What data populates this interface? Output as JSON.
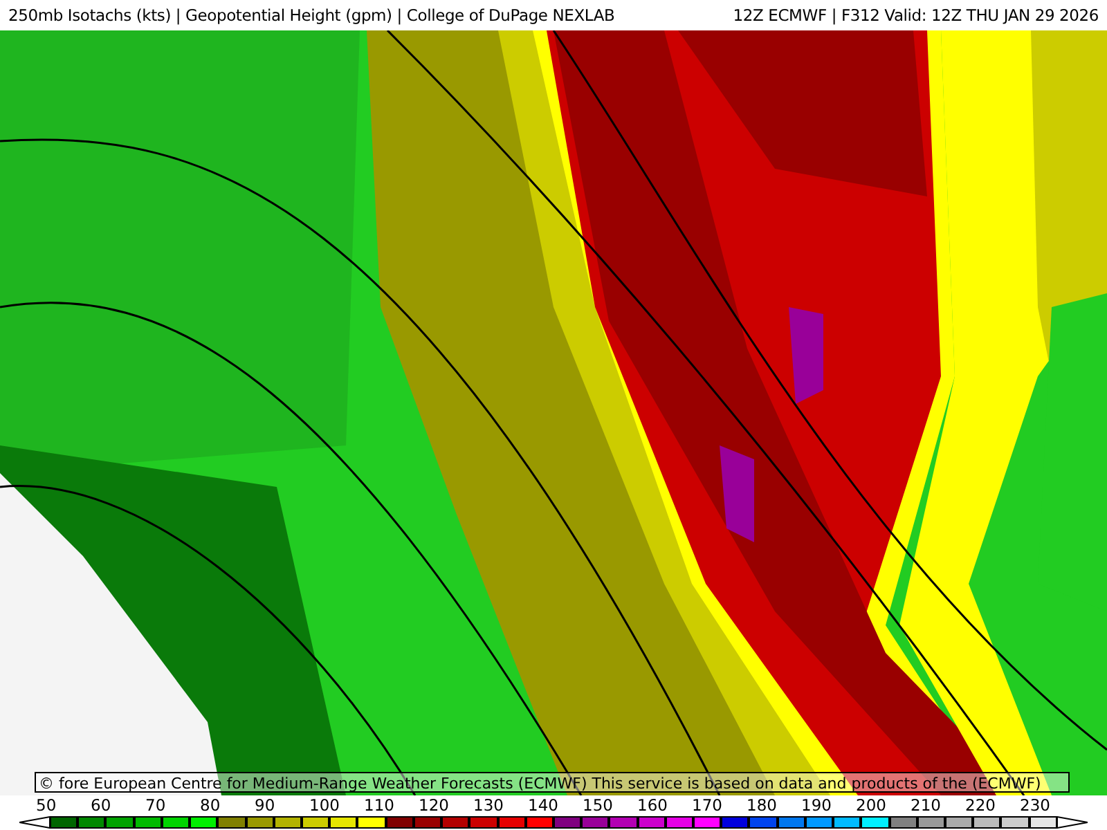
{
  "header": {
    "title": "250mb Isotachs (kts) | Geopotential Height (gpm) | College of DuPage NEXLAB",
    "run": "12Z ECMWF | F312 Valid: 12Z THU JAN 29 2026"
  },
  "copyright": "© fore European Centre for Medium-Range Weather Forecasts (ECMWF)  This service is based on data and products of the (ECMWF)",
  "colorbar": {
    "labels": [
      "50",
      "60",
      "70",
      "80",
      "90",
      "100",
      "110",
      "120",
      "130",
      "140",
      "150",
      "160",
      "170",
      "180",
      "190",
      "200",
      "210",
      "220",
      "230"
    ],
    "swatches": [
      {
        "color": "#006600"
      },
      {
        "color": "#008800"
      },
      {
        "color": "#00a300"
      },
      {
        "color": "#00bb00"
      },
      {
        "color": "#00d400"
      },
      {
        "color": "#00ee00"
      },
      {
        "color": "#808000"
      },
      {
        "color": "#999900"
      },
      {
        "color": "#b3b300"
      },
      {
        "color": "#cccc00"
      },
      {
        "color": "#e6e600"
      },
      {
        "color": "#ffff00"
      },
      {
        "color": "#800000"
      },
      {
        "color": "#990000"
      },
      {
        "color": "#b30000"
      },
      {
        "color": "#cc0000"
      },
      {
        "color": "#e60000"
      },
      {
        "color": "#ff0000"
      },
      {
        "color": "#800080"
      },
      {
        "color": "#990099"
      },
      {
        "color": "#b300b3"
      },
      {
        "color": "#cc00cc"
      },
      {
        "color": "#e600e6"
      },
      {
        "color": "#ff00ff"
      },
      {
        "color": "#0000dd"
      },
      {
        "color": "#0044ee"
      },
      {
        "color": "#0077ee"
      },
      {
        "color": "#0099ff"
      },
      {
        "color": "#00bbff"
      },
      {
        "color": "#00eeff"
      },
      {
        "color": "#808080"
      },
      {
        "color": "#999999"
      },
      {
        "color": "#aaaaaa"
      },
      {
        "color": "#bbbbbb"
      },
      {
        "color": "#cccccc"
      },
      {
        "color": "#e6e6e6"
      }
    ]
  }
}
